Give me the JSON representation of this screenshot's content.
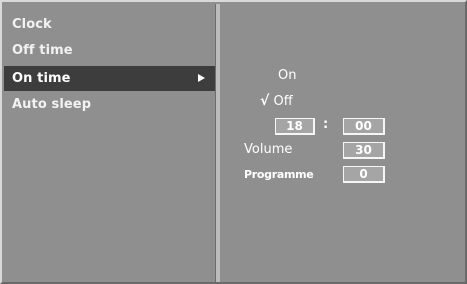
{
  "menu": {
    "items": [
      {
        "label": "Clock"
      },
      {
        "label": "Off time"
      },
      {
        "label": "On time",
        "selected": true
      },
      {
        "label": "Auto sleep"
      }
    ]
  },
  "settings": {
    "on_label": "On",
    "off_check": "√",
    "off_label": "Off",
    "hour": "18",
    "time_separator": ":",
    "minute": "00",
    "volume_label": "Volume",
    "volume_value": "30",
    "programme_label": "Programme",
    "programme_value": "0"
  },
  "icons": {
    "submenu": "right-triangle-icon"
  },
  "colors": {
    "panel": "#8f8f8f",
    "selected": "#3d3d3d",
    "text": "#ffffff"
  }
}
